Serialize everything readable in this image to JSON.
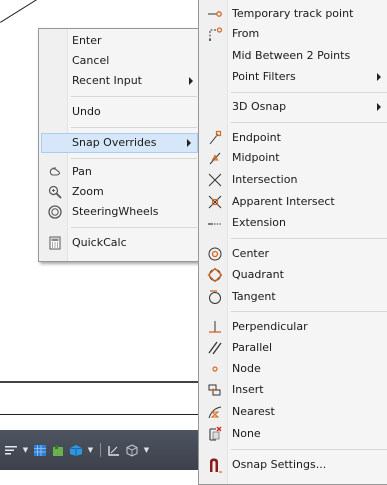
{
  "context_menu": {
    "items": [
      {
        "label": "Enter"
      },
      {
        "label": "Cancel"
      },
      {
        "label": "Recent Input"
      },
      {
        "label": "Undo"
      },
      {
        "label": "Snap Overrides"
      },
      {
        "label": "Pan",
        "icon": "pan-icon"
      },
      {
        "label": "Zoom",
        "icon": "zoom-icon"
      },
      {
        "label": "SteeringWheels",
        "icon": "steeringwheels-icon"
      },
      {
        "label": "QuickCalc",
        "icon": "calculator-icon"
      }
    ]
  },
  "snap_menu": {
    "items": [
      {
        "label": "Temporary track point",
        "icon": "track-point-icon"
      },
      {
        "label": "From",
        "icon": "from-icon"
      },
      {
        "label": "Mid Between 2 Points"
      },
      {
        "label": "Point Filters"
      },
      {
        "label": "3D Osnap"
      },
      {
        "label": "Endpoint",
        "icon": "endpoint-icon"
      },
      {
        "label": "Midpoint",
        "icon": "midpoint-icon"
      },
      {
        "label": "Intersection",
        "icon": "intersection-icon"
      },
      {
        "label": "Apparent Intersect",
        "icon": "apparent-intersect-icon"
      },
      {
        "label": "Extension",
        "icon": "extension-icon"
      },
      {
        "label": "Center",
        "icon": "center-icon"
      },
      {
        "label": "Quadrant",
        "icon": "quadrant-icon"
      },
      {
        "label": "Tangent",
        "icon": "tangent-icon"
      },
      {
        "label": "Perpendicular",
        "icon": "perpendicular-icon"
      },
      {
        "label": "Parallel",
        "icon": "parallel-icon"
      },
      {
        "label": "Node",
        "icon": "node-icon"
      },
      {
        "label": "Insert",
        "icon": "insert-icon"
      },
      {
        "label": "Nearest",
        "icon": "nearest-icon"
      },
      {
        "label": "None",
        "icon": "none-icon"
      },
      {
        "label": "Osnap Settings...",
        "icon": "osnap-settings-icon"
      }
    ]
  },
  "colors": {
    "highlight": "#d5e7f8",
    "highlight_border": "#a9cdf0",
    "osnap_icon": "#d2691e",
    "statusbar": "#474c56"
  }
}
